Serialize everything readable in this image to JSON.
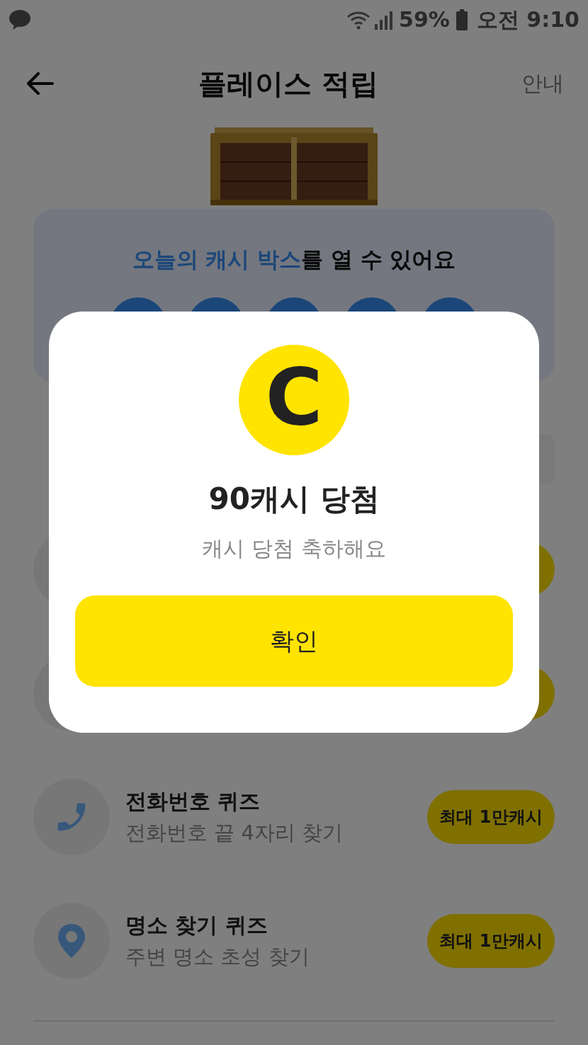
{
  "status_bar": {
    "battery": "59%",
    "time": "오전 9:10"
  },
  "header": {
    "title": "플레이스 적립",
    "info_link": "안내"
  },
  "cash_box": {
    "title_highlight": "오늘의 캐시 박스",
    "title_rest": "를 열 수 있어요"
  },
  "quizzes": [
    {
      "kind": "covered"
    },
    {
      "kind": "covered"
    },
    {
      "kind": "phone",
      "title": "전화번호 퀴즈",
      "subtitle": "전화번호 끝 4자리 찾기",
      "reward": "최대 1만캐시"
    },
    {
      "kind": "location",
      "title": "명소 찾기 퀴즈",
      "subtitle": "주변 명소 초성 찾기",
      "reward": "최대 1만캐시"
    }
  ],
  "dialog": {
    "coin_letter": "C",
    "title": "90캐시 당첨",
    "message": "캐시 당첨 축하해요",
    "confirm": "확인"
  }
}
